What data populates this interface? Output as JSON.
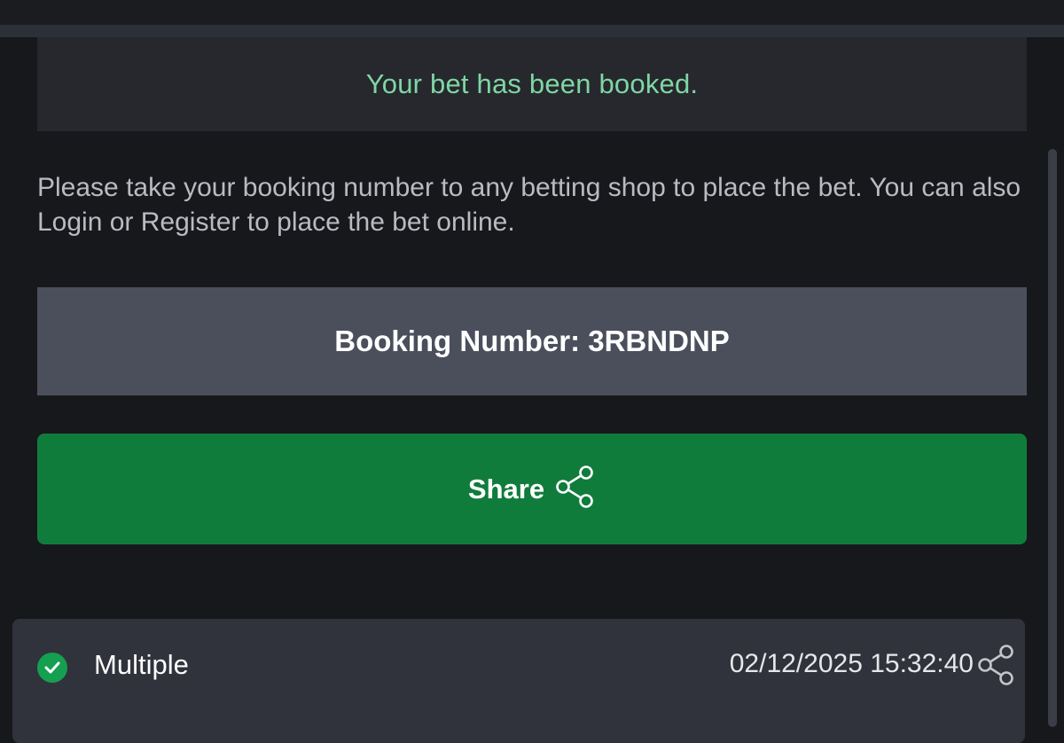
{
  "confirmation": {
    "message": "Your bet has been booked."
  },
  "info": {
    "text": "Please take your booking number to any betting shop to place the bet. You can also Login or Register to place the bet online."
  },
  "booking": {
    "label": "Booking Number: 3RBNDNP"
  },
  "share_button": {
    "label": "Share",
    "icon": "share-icon"
  },
  "bet_card": {
    "status_icon": "check-circle-icon",
    "type": "Multiple",
    "datetime": "02/12/2025 15:32:40",
    "share_icon": "share-icon"
  },
  "colors": {
    "accent_green": "#0f7c3c",
    "confirm_text": "#7fd6a4",
    "background": "#17181c",
    "booking_box": "#4b4f5c"
  }
}
